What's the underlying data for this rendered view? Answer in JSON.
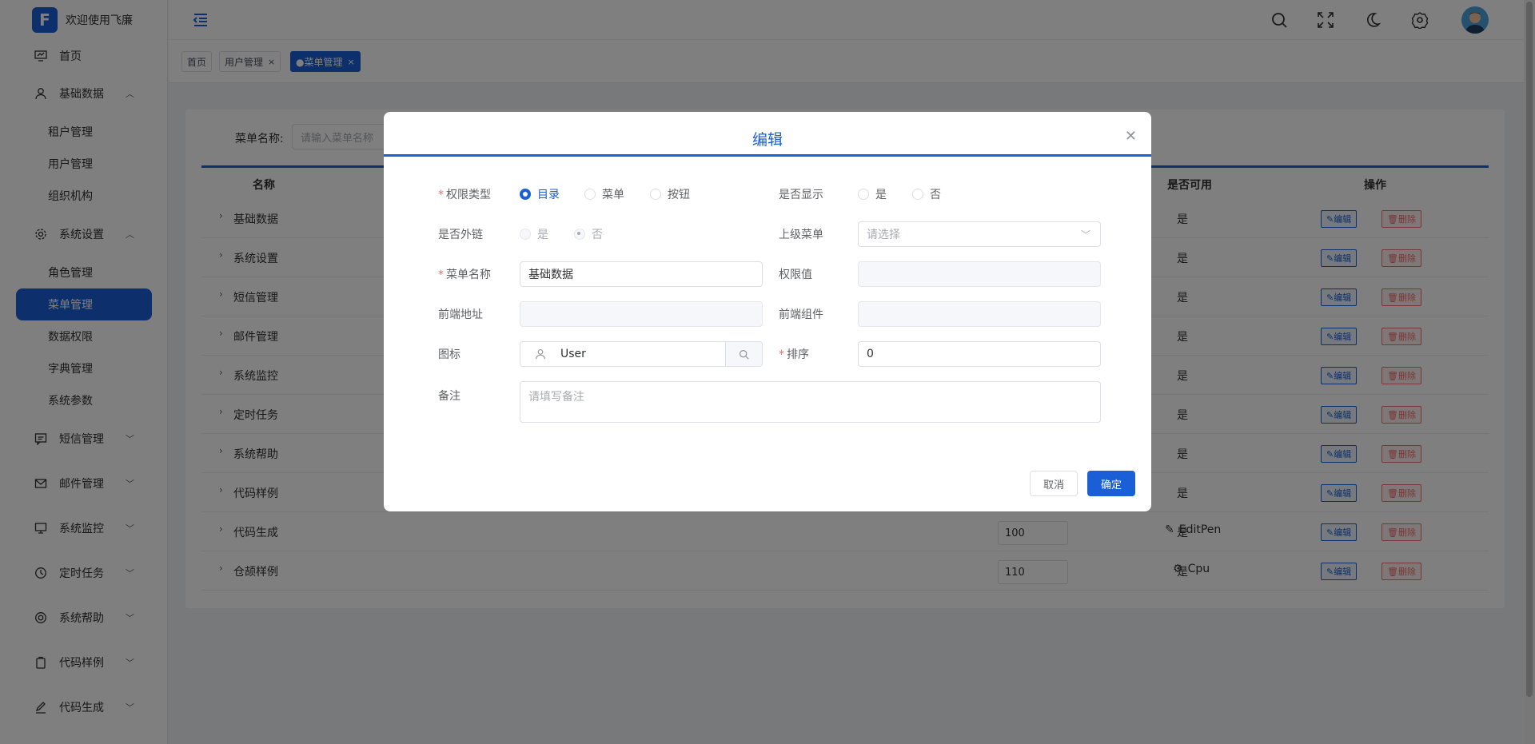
{
  "brand": {
    "logo_letter": "F",
    "title": "欢迎使用飞廉"
  },
  "sidebar": {
    "items": [
      {
        "label": "首页",
        "icon": "dashboard-icon"
      },
      {
        "label": "基础数据",
        "icon": "user-icon",
        "arrow": "^"
      },
      {
        "label": "系统设置",
        "icon": "gear-icon",
        "arrow": "^"
      },
      {
        "label": "短信管理",
        "icon": "message-icon",
        "arrow": "v"
      },
      {
        "label": "邮件管理",
        "icon": "mail-icon",
        "arrow": "v"
      },
      {
        "label": "系统监控",
        "icon": "monitor-icon",
        "arrow": "v"
      },
      {
        "label": "定时任务",
        "icon": "clock-icon",
        "arrow": "v"
      },
      {
        "label": "系统帮助",
        "icon": "help-icon",
        "arrow": "v"
      },
      {
        "label": "代码样例",
        "icon": "clipboard-icon",
        "arrow": "v"
      },
      {
        "label": "代码生成",
        "icon": "edit-pen-icon",
        "arrow": "v"
      }
    ],
    "sub_basic": [
      "租户管理",
      "用户管理",
      "组织机构"
    ],
    "sub_system": [
      "角色管理",
      "菜单管理",
      "数据权限",
      "字典管理",
      "系统参数"
    ]
  },
  "tabs": [
    {
      "label": "首页"
    },
    {
      "label": "用户管理",
      "close": "×"
    },
    {
      "label": "●菜单管理",
      "close": "×"
    }
  ],
  "filter": {
    "label": "菜单名称:",
    "placeholder": "请输入菜单名称"
  },
  "table": {
    "headers": {
      "name": "名称",
      "available": "是否可用",
      "actions": "操作"
    },
    "edit_label": "编辑",
    "delete_label": "删除",
    "rows": [
      {
        "name": "基础数据",
        "available": "是"
      },
      {
        "name": "系统设置",
        "available": "是"
      },
      {
        "name": "短信管理",
        "available": "是"
      },
      {
        "name": "邮件管理",
        "available": "是"
      },
      {
        "name": "系统监控",
        "available": "是"
      },
      {
        "name": "定时任务",
        "available": "是"
      },
      {
        "name": "系统帮助",
        "available": "是"
      },
      {
        "name": "代码样例",
        "available": "是"
      },
      {
        "name": "代码生成",
        "available": "是",
        "sort": "100",
        "icon": "EditPen"
      },
      {
        "name": "仓颉样例",
        "available": "是",
        "sort": "110",
        "icon": "Cpu"
      }
    ]
  },
  "dialog": {
    "title": "编辑",
    "perm_type_label": "权限类型",
    "perm_type_options": [
      "目录",
      "菜单",
      "按钮"
    ],
    "perm_type_selected": "目录",
    "show_label": "是否显示",
    "show_options": [
      "是",
      "否"
    ],
    "external_label": "是否外链",
    "external_options": [
      "是",
      "否"
    ],
    "parent_label": "上级菜单",
    "parent_placeholder": "请选择",
    "name_label": "菜单名称",
    "name_value": "基础数据",
    "perm_value_label": "权限值",
    "front_addr_label": "前端地址",
    "front_comp_label": "前端组件",
    "icon_label": "图标",
    "icon_value": "User",
    "sort_label": "排序",
    "sort_value": "0",
    "remark_label": "备注",
    "remark_placeholder": "请填写备注",
    "cancel_label": "取消",
    "ok_label": "确定"
  },
  "colors": {
    "primary": "#1a5fd6",
    "danger": "#f56c6c"
  }
}
